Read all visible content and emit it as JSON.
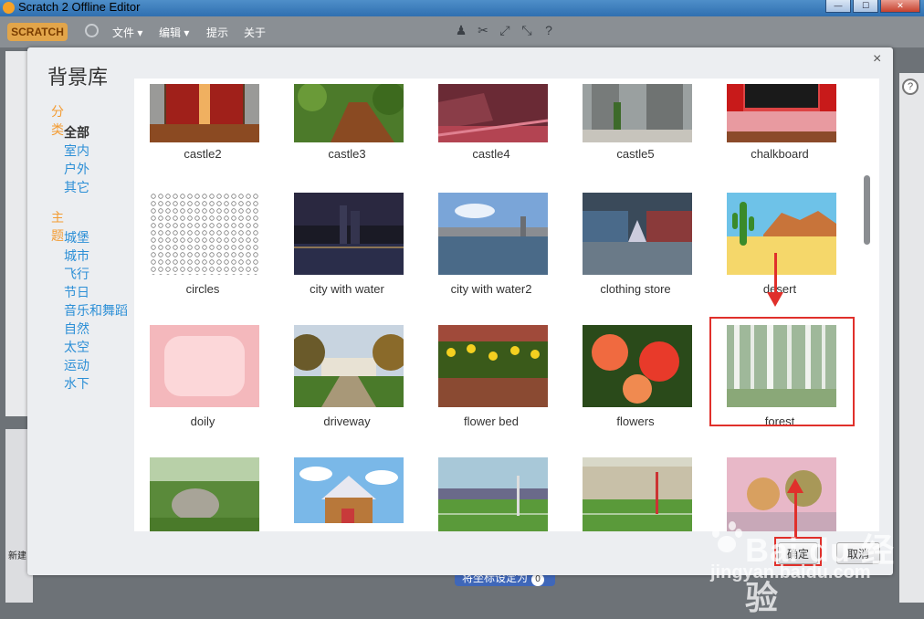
{
  "window": {
    "title": "Scratch 2 Offline Editor",
    "minimize": "—",
    "maximize": "☐",
    "close": "✕"
  },
  "menubar": {
    "logo": "SCRATCH",
    "items": [
      "文件 ▾",
      "编辑 ▾",
      "提示",
      "关于"
    ],
    "tool_icons": [
      "stamp-icon",
      "scissors-icon",
      "grow-icon",
      "shrink-icon",
      "help-icon"
    ],
    "tool_glyphs": [
      "♟",
      "✂",
      "⤢",
      "⤡",
      "?"
    ]
  },
  "dialog": {
    "title": "背景库",
    "close": "×",
    "sidebar": {
      "category_heading": "分类",
      "categories": [
        "全部",
        "室内",
        "户外",
        "其它"
      ],
      "theme_heading": "主题",
      "themes": [
        "城堡",
        "城市",
        "飞行",
        "节日",
        "音乐和舞蹈",
        "自然",
        "太空",
        "运动",
        "水下"
      ]
    },
    "rows": [
      [
        "castle2",
        "castle3",
        "castle4",
        "castle5",
        "chalkboard"
      ],
      [
        "circles",
        "city with water",
        "city with water2",
        "clothing store",
        "desert"
      ],
      [
        "doily",
        "driveway",
        "flower bed",
        "flowers",
        "forest"
      ],
      [
        "",
        "",
        "",
        "",
        ""
      ]
    ],
    "buttons": {
      "ok": "确定",
      "cancel": "取消"
    }
  },
  "editor": {
    "new_label": "新建",
    "coord_button": "将坐标设定为",
    "coord_count": "0",
    "help": "?"
  },
  "watermark": {
    "brand": "Bai du 经验",
    "url": "jingyan.baidu.com"
  },
  "colors": {
    "accent_orange": "#f39c33",
    "link_blue": "#2c8fd6",
    "highlight_red": "#e0302b"
  }
}
